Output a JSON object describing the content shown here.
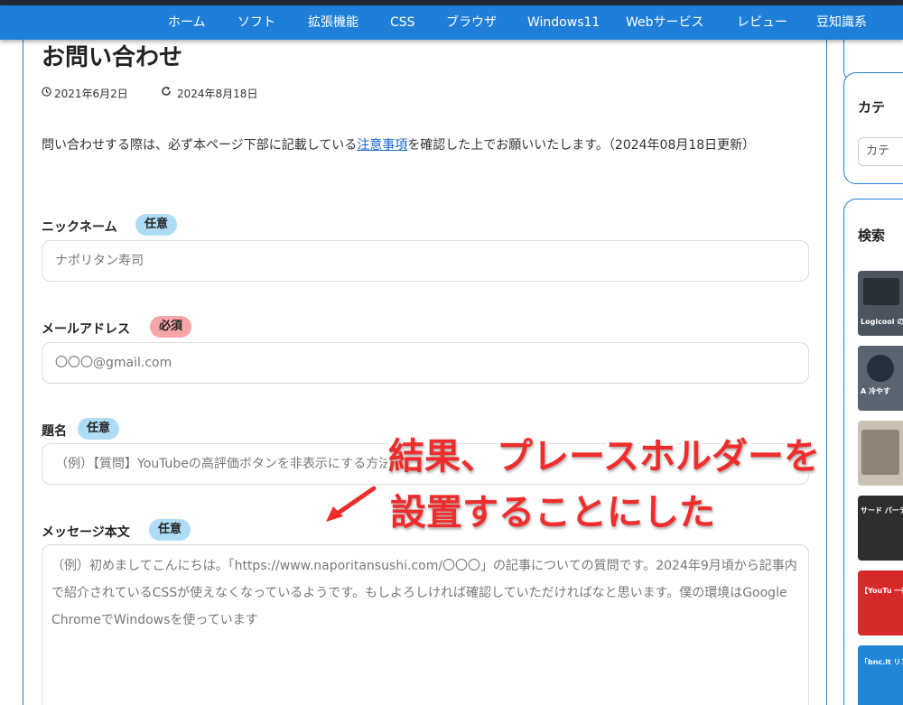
{
  "nav": {
    "items": [
      "ホーム",
      "ソフト",
      "拡張機能",
      "CSS",
      "ブラウザ",
      "Windows11",
      "Webサービス",
      "レビュー",
      "豆知識系"
    ]
  },
  "page": {
    "title": "お問い合わせ",
    "published": "2021年6月2日",
    "updated": "2024年8月18日",
    "intro_before": "問い合わせする際は、必ず本ページ下部に記載している",
    "intro_link": "注意事項",
    "intro_after": "を確認した上でお願いいたします。（2024年08月18日更新）"
  },
  "form": {
    "nickname": {
      "label": "ニックネーム",
      "badge": "任意",
      "placeholder": "ナポリタン寿司"
    },
    "email": {
      "label": "メールアドレス",
      "badge": "必須",
      "placeholder": "〇〇〇@gmail.com"
    },
    "subject": {
      "label": "題名",
      "badge": "任意",
      "placeholder": "（例）【質問】YouTubeの高評価ボタンを非表示にする方法について"
    },
    "message": {
      "label": "メッセージ本文",
      "badge": "任意",
      "placeholder": "（例）初めましてこんにちは。「https://www.naporitansushi.com/〇〇〇」の記事についての質問です。2024年9月頃から記事内で紹介されているCSSが使えなくなっているようです。もしよろしければ確認していただければなと思います。僕の環境はGoogle ChromeでWindowsを使っています"
    }
  },
  "overlay": {
    "line1_black": "結果",
    "line1_comma": "、",
    "line1_red": "プレースホルダーを",
    "line2": "設置することにした"
  },
  "sidebar": {
    "category_title": "カテ",
    "category_select": "カテ",
    "search_title": "検索",
    "thumbs": [
      "Logicool の MX MECH",
      "A 冷やす",
      "",
      "サード パーティ レンズ 認識す",
      "【YouTu 一行の 表示数 JavaScr",
      "「bnc.lt リンク スパム 拡張機"
    ]
  },
  "colors": {
    "nav_bg": "#1f7fd8",
    "badge_optional": "#aedcf5",
    "badge_required": "#f5a4a8",
    "overlay_red": "#ef2d2d",
    "link": "#1a66c9"
  }
}
